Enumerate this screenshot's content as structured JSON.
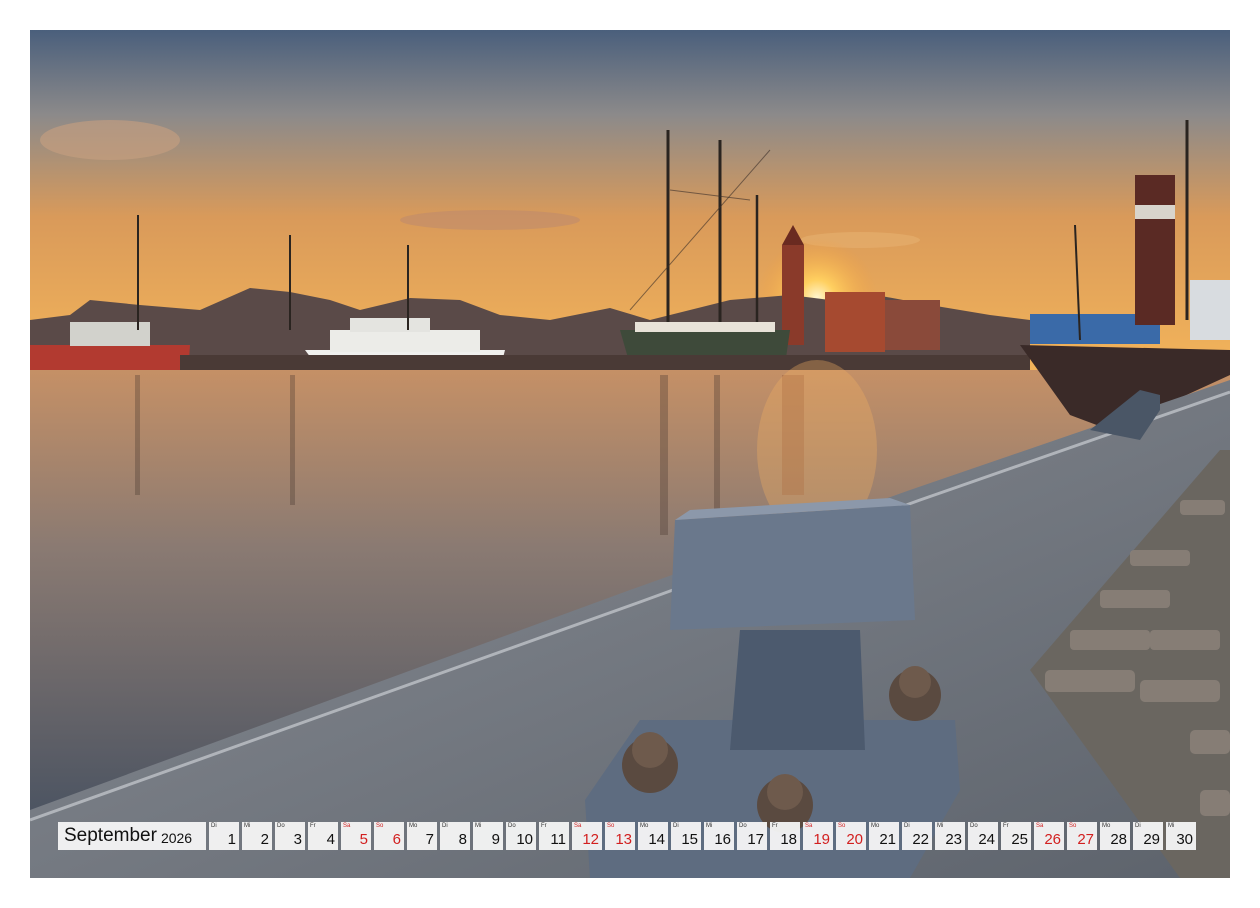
{
  "calendar": {
    "month": "September",
    "year": "2026",
    "weekend_color": "#d21f1f",
    "days": [
      {
        "wd": "Di",
        "num": "1",
        "weekend": false
      },
      {
        "wd": "Mi",
        "num": "2",
        "weekend": false
      },
      {
        "wd": "Do",
        "num": "3",
        "weekend": false
      },
      {
        "wd": "Fr",
        "num": "4",
        "weekend": false
      },
      {
        "wd": "Sa",
        "num": "5",
        "weekend": true
      },
      {
        "wd": "So",
        "num": "6",
        "weekend": true
      },
      {
        "wd": "Mo",
        "num": "7",
        "weekend": false
      },
      {
        "wd": "Di",
        "num": "8",
        "weekend": false
      },
      {
        "wd": "Mi",
        "num": "9",
        "weekend": false
      },
      {
        "wd": "Do",
        "num": "10",
        "weekend": false
      },
      {
        "wd": "Fr",
        "num": "11",
        "weekend": false
      },
      {
        "wd": "Sa",
        "num": "12",
        "weekend": true
      },
      {
        "wd": "So",
        "num": "13",
        "weekend": true
      },
      {
        "wd": "Mo",
        "num": "14",
        "weekend": false
      },
      {
        "wd": "Di",
        "num": "15",
        "weekend": false
      },
      {
        "wd": "Mi",
        "num": "16",
        "weekend": false
      },
      {
        "wd": "Do",
        "num": "17",
        "weekend": false
      },
      {
        "wd": "Fr",
        "num": "18",
        "weekend": false
      },
      {
        "wd": "Sa",
        "num": "19",
        "weekend": true
      },
      {
        "wd": "So",
        "num": "20",
        "weekend": true
      },
      {
        "wd": "Mo",
        "num": "21",
        "weekend": false
      },
      {
        "wd": "Di",
        "num": "22",
        "weekend": false
      },
      {
        "wd": "Mi",
        "num": "23",
        "weekend": false
      },
      {
        "wd": "Do",
        "num": "24",
        "weekend": false
      },
      {
        "wd": "Fr",
        "num": "25",
        "weekend": false
      },
      {
        "wd": "Sa",
        "num": "26",
        "weekend": true
      },
      {
        "wd": "So",
        "num": "27",
        "weekend": true
      },
      {
        "wd": "Mo",
        "num": "28",
        "weekend": false
      },
      {
        "wd": "Di",
        "num": "29",
        "weekend": false
      },
      {
        "wd": "Mi",
        "num": "30",
        "weekend": false
      }
    ]
  }
}
